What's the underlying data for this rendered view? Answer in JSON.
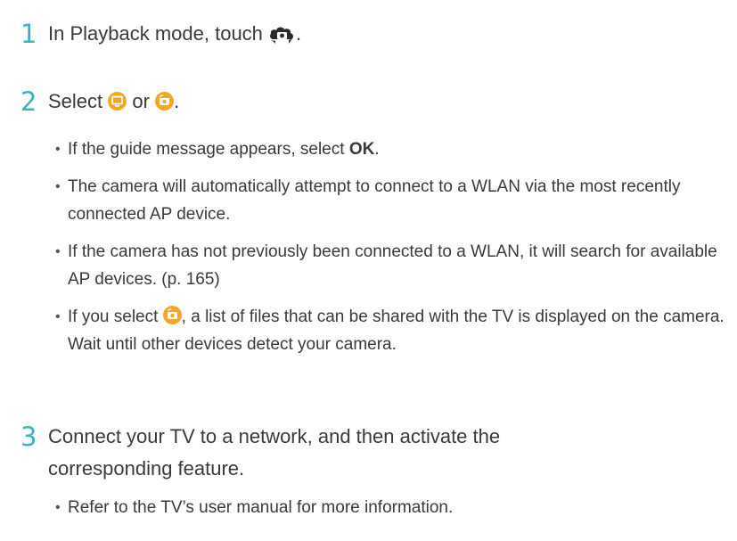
{
  "steps": [
    {
      "number": "1",
      "text_before": "In Playback mode, touch",
      "text_after": ".",
      "icon": "share-camera-icon"
    },
    {
      "number": "2",
      "text_before": "Select",
      "text_mid": "or",
      "text_after": ".",
      "icons": [
        "tv-screen-icon",
        "camera-share-icon"
      ],
      "bullets": {
        "b1": {
          "before": "If the guide message appears, select ",
          "bold": "OK",
          "after": "."
        },
        "b2": "The camera will automatically attempt to connect to a WLAN via the most recently connected AP device.",
        "b3": "If the camera has not previously been connected to a WLAN, it will search for available AP devices. (p. 165)",
        "b4": {
          "before": "If you select",
          "after": ", a list of files that can be shared with the TV is displayed on the camera. Wait until other devices detect your camera."
        }
      }
    },
    {
      "number": "3",
      "text": "Connect your TV to a network, and then activate the corresponding feature.",
      "bullets": {
        "b1": "Refer to the TV’s user manual for more information."
      }
    }
  ],
  "colors": {
    "step_number": "#38b4bc",
    "icon_orange": "#f5a623",
    "text": "#3a3a3a"
  }
}
